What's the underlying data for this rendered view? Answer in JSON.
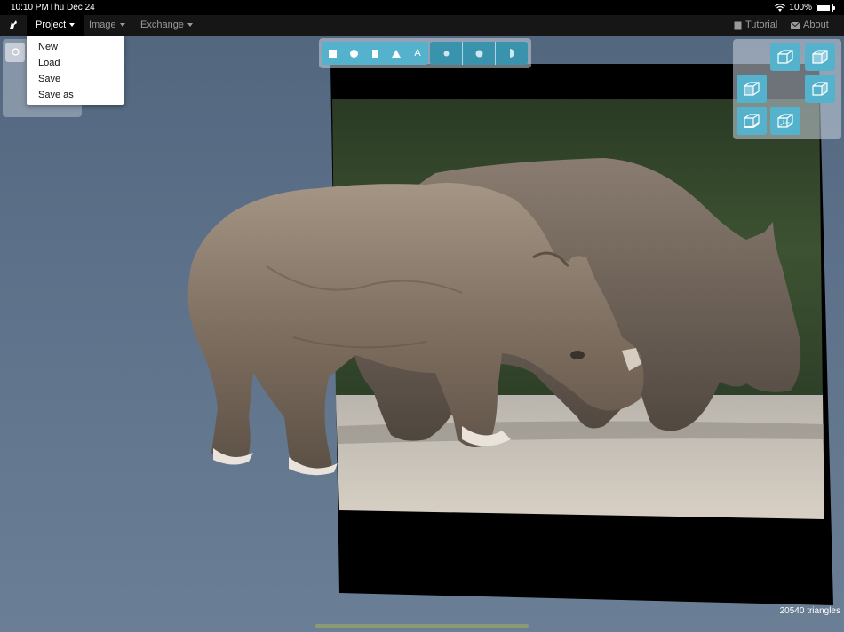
{
  "status": {
    "time": "10:10 PM",
    "date": "Thu Dec 24",
    "battery": "100%"
  },
  "menu": {
    "project": "Project",
    "image": "Image",
    "exchange": "Exchange",
    "tutorial": "Tutorial",
    "about": "About"
  },
  "project_menu": {
    "items": [
      "New",
      "Load",
      "Save",
      "Save as"
    ]
  },
  "toolbar": {
    "shapes": [
      "square-icon",
      "circle-icon",
      "rectangle-icon",
      "triangle-icon",
      "text-icon"
    ],
    "text_label": "A",
    "brushes": [
      "brush-small-icon",
      "brush-large-icon",
      "brush-half-icon"
    ]
  },
  "views": [
    "view-front-icon",
    "view-top-icon",
    "view-left-icon",
    "view-right-icon",
    "view-bottom-icon",
    "view-back-icon"
  ],
  "scene": {
    "triangle_count": "20540 triangles"
  },
  "colors": {
    "accent": "#54b2cc",
    "accent_dark": "#3a93ad",
    "menubar": "#161616"
  }
}
